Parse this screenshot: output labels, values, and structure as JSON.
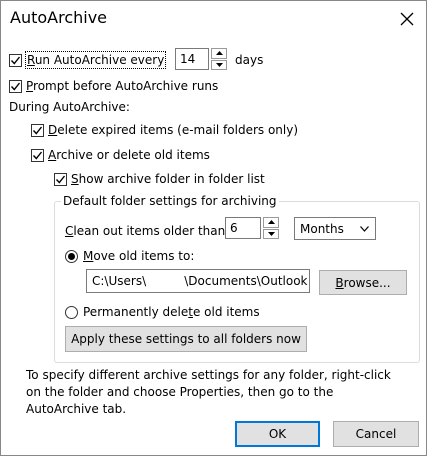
{
  "window": {
    "title": "AutoArchive"
  },
  "run_autoarchive": {
    "label_prefix": "R",
    "label_rest": "un AutoArchive every",
    "checked": true,
    "days_value": "14",
    "days_unit": "days"
  },
  "prompt_before": {
    "label_prefix": "P",
    "label_rest": "rompt before AutoArchive runs",
    "checked": true
  },
  "during_label": "During AutoArchive:",
  "delete_expired": {
    "label_prefix": "D",
    "label_rest": "elete expired items (e-mail folders only)",
    "checked": true
  },
  "archive_old": {
    "label_prefix": "A",
    "label_rest": "rchive or delete old items",
    "checked": true
  },
  "show_folder": {
    "label_prefix": "S",
    "label_rest": "how archive folder in folder list",
    "checked": true
  },
  "defaults_group": {
    "title": "Default folder settings for archiving",
    "clean_out_label_prefix": "C",
    "clean_out_label_rest": "lean out items older than",
    "age_value": "6",
    "age_unit": "Months",
    "move_label_prefix": "M",
    "move_label_rest": "ove old items to:",
    "move_selected": true,
    "path_value": "C:\\Users\\          \\Documents\\Outlook Fil",
    "browse_label_prefix": "B",
    "browse_label_rest": "rowse...",
    "permanent_label_a": "Permanently dele",
    "permanent_label_u": "t",
    "permanent_label_b": "e old items",
    "apply_label": "Apply these settings to all folders now"
  },
  "note": "To specify different archive settings for any folder, right-click on the folder and choose Properties, then go to the AutoArchive tab.",
  "buttons": {
    "ok": "OK",
    "cancel": "Cancel"
  },
  "icons": {
    "close": "close-icon",
    "check": "checkmark-icon",
    "up": "chevron-up-icon",
    "down": "chevron-down-icon"
  }
}
